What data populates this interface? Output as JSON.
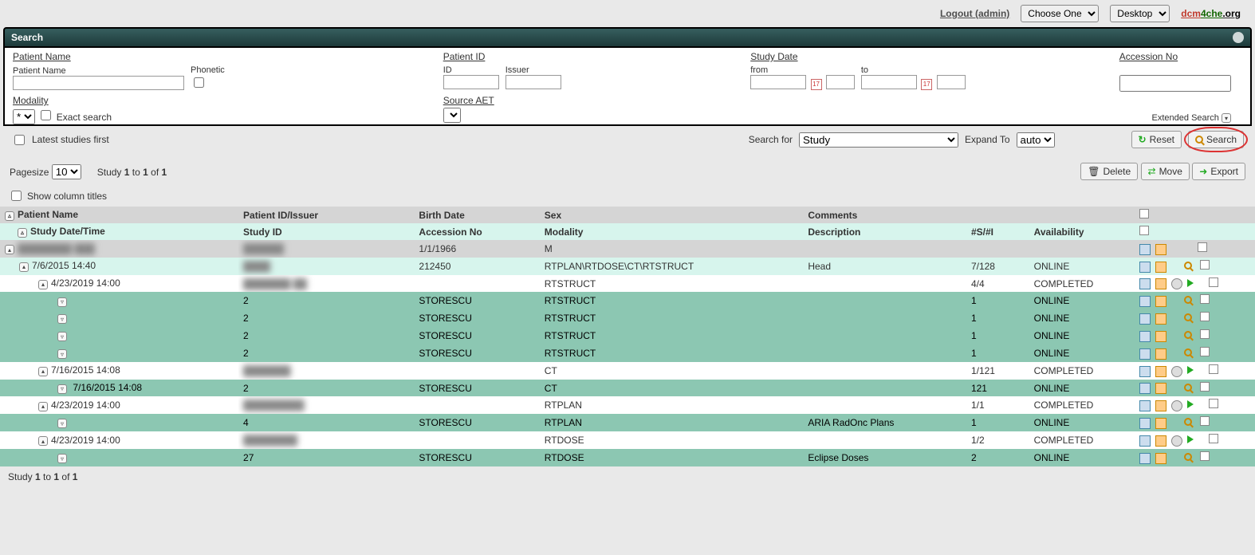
{
  "topbar": {
    "logout_label": "Logout (admin)",
    "select1": "Choose One",
    "select2": "Desktop",
    "brand1": "dcm",
    "brand2": "4che",
    "brand3": ".org"
  },
  "panel": {
    "title": "Search"
  },
  "search": {
    "patient_name": {
      "label": "Patient Name",
      "sub1": "Patient Name",
      "sub2": "Phonetic"
    },
    "patient_id": {
      "label": "Patient ID",
      "sub1": "ID",
      "sub2": "Issuer"
    },
    "study_date": {
      "label": "Study Date",
      "sub1": "from",
      "sub2": "to"
    },
    "accession": {
      "label": "Accession No"
    },
    "modality": {
      "label": "Modality",
      "value": "*",
      "exact_label": "Exact search"
    },
    "source_aet": {
      "label": "Source AET"
    },
    "extended_label": "Extended Search"
  },
  "controls": {
    "latest_label": "Latest studies first",
    "search_for_label": "Search for",
    "search_for_value": "Study",
    "expand_to_label": "Expand To",
    "expand_to_value": "auto",
    "reset_label": "Reset",
    "search_label": "Search"
  },
  "pager": {
    "pagesize_label": "Pagesize",
    "pagesize_value": "10",
    "summary_prefix": "Study ",
    "summary_from": "1",
    "summary_to_join": " to ",
    "summary_to": "1",
    "summary_of_join": " of ",
    "summary_total": "1",
    "delete_label": "Delete",
    "move_label": "Move",
    "export_label": "Export",
    "show_titles_label": "Show column titles"
  },
  "columns": {
    "h1": {
      "c1": "Patient Name",
      "c2": "Patient ID/Issuer",
      "c3": "Birth Date",
      "c4": "Sex",
      "c5": "Comments"
    },
    "h2": {
      "c1": "Study Date/Time",
      "c2": "Study ID",
      "c3": "Accession No",
      "c4": "Modality",
      "c5": "Description",
      "c6": "#S/#I",
      "c7": "Availability"
    }
  },
  "rows": {
    "patient": {
      "birth": "1/1/1966",
      "sex": "M"
    },
    "study": {
      "date": "7/6/2015 14:40",
      "acc": "212450",
      "mod": "RTPLAN\\RTDOSE\\CT\\RTSTRUCT",
      "desc": "Head",
      "ss": "7/128",
      "av": "ONLINE"
    },
    "series": [
      {
        "date": "4/23/2019 14:00",
        "mod": "RTSTRUCT",
        "ss": "4/4",
        "av": "COMPLETED",
        "indent": 2
      },
      {
        "date": "7/16/2015 14:08",
        "mod": "CT",
        "ss": "1/121",
        "av": "COMPLETED",
        "indent": 2
      },
      {
        "date": "4/23/2019 14:00",
        "mod": "RTPLAN",
        "ss": "1/1",
        "av": "COMPLETED",
        "indent": 2
      },
      {
        "date": "4/23/2019 14:00",
        "mod": "RTDOSE",
        "ss": "1/2",
        "av": "COMPLETED",
        "indent": 2
      }
    ],
    "instances_group_a": [
      {
        "inst": "2",
        "src": "STORESCU",
        "mod": "RTSTRUCT",
        "ss": "1",
        "av": "ONLINE"
      },
      {
        "inst": "2",
        "src": "STORESCU",
        "mod": "RTSTRUCT",
        "ss": "1",
        "av": "ONLINE"
      },
      {
        "inst": "2",
        "src": "STORESCU",
        "mod": "RTSTRUCT",
        "ss": "1",
        "av": "ONLINE"
      },
      {
        "inst": "2",
        "src": "STORESCU",
        "mod": "RTSTRUCT",
        "ss": "1",
        "av": "ONLINE"
      }
    ],
    "instance_ct": {
      "date": "7/16/2015 14:08",
      "inst": "2",
      "src": "STORESCU",
      "mod": "CT",
      "ss": "121",
      "av": "ONLINE"
    },
    "instance_rtplan": {
      "inst": "4",
      "src": "STORESCU",
      "mod": "RTPLAN",
      "desc": "ARIA RadOnc Plans",
      "ss": "1",
      "av": "ONLINE"
    },
    "instance_rtdose": {
      "inst": "27",
      "src": "STORESCU",
      "mod": "RTDOSE",
      "desc": "Eclipse Doses",
      "ss": "2",
      "av": "ONLINE"
    }
  },
  "footer": {
    "summary_prefix": "Study ",
    "summary_from": "1",
    "summary_to_join": " to ",
    "summary_to": "1",
    "summary_of_join": " of ",
    "summary_total": "1"
  }
}
